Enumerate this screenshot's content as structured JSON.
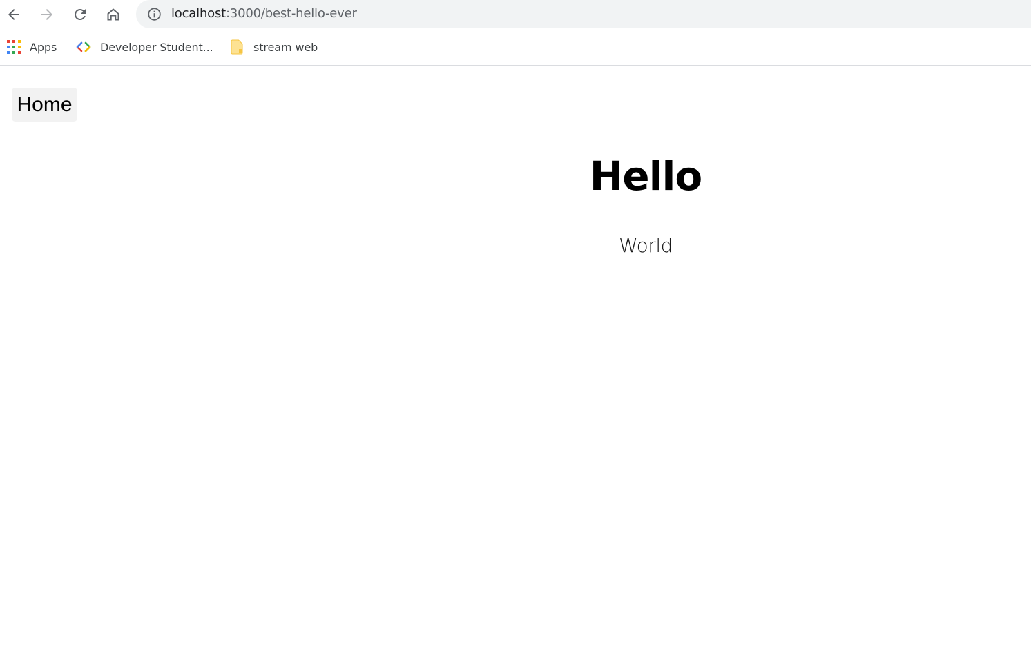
{
  "browser": {
    "nav": {
      "back_icon": "arrow-left-icon",
      "forward_icon": "arrow-right-icon",
      "reload_icon": "reload-icon",
      "home_icon": "home-icon"
    },
    "omnibox": {
      "info_icon": "info-circle-icon",
      "url_host": "localhost",
      "url_path": ":3000/best-hello-ever"
    },
    "bookmarks": [
      {
        "label": "Apps",
        "icon": "apps-grid-icon"
      },
      {
        "label": "Developer Student...",
        "icon": "developer-chevrons-icon"
      },
      {
        "label": "stream web",
        "icon": "folder-icon"
      }
    ],
    "colors": {
      "omnibox_bg": "#f1f3f4",
      "bookmark_divider": "#dadce0"
    }
  },
  "page": {
    "home_button_label": "Home",
    "heading": "Hello",
    "subheading": "World"
  }
}
